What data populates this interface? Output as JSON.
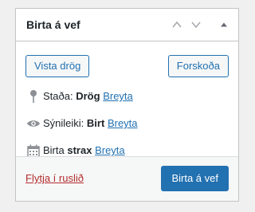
{
  "panel": {
    "title": "Birta á vef",
    "controls": {
      "move_up_icon": "chevron-up-icon",
      "move_down_icon": "chevron-down-icon",
      "toggle_icon": "triangle-up-icon"
    }
  },
  "actions": {
    "save_draft_label": "Vista drög",
    "preview_label": "Forskoða"
  },
  "status": {
    "label": "Staða:",
    "value": "Drög",
    "edit_label": "Breyta",
    "icon": "pin-icon"
  },
  "visibility": {
    "label": "Sýnileiki:",
    "value": "Birt",
    "edit_label": "Breyta",
    "icon": "eye-icon"
  },
  "schedule": {
    "label": "Birta",
    "value": "strax",
    "edit_label": "Breyta",
    "icon": "calendar-icon"
  },
  "footer": {
    "trash_label": "Flytja í ruslið",
    "publish_label": "Birta á vef"
  },
  "colors": {
    "accent": "#2271b1",
    "danger": "#b32d2e",
    "border": "#c3c4c7",
    "footer_bg": "#f6f7f7"
  }
}
